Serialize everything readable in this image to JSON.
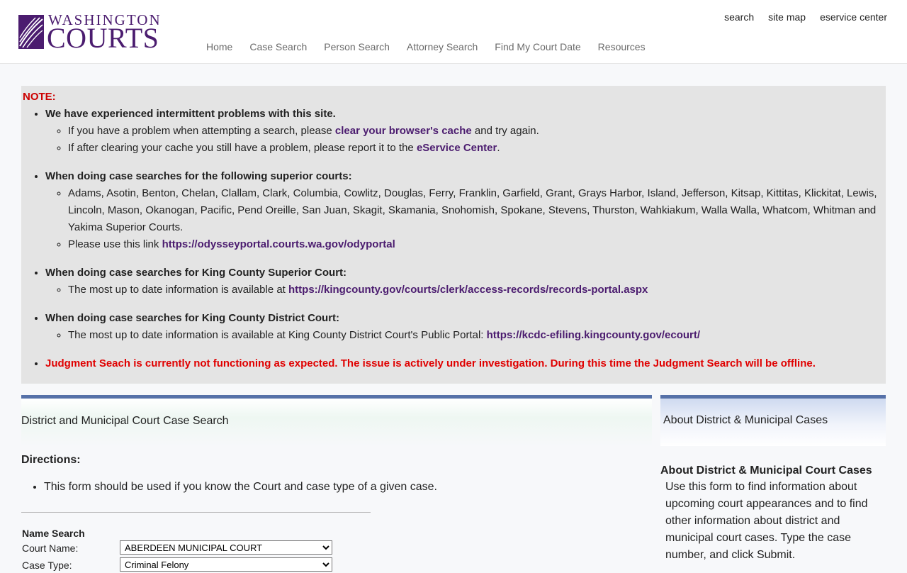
{
  "brand": {
    "top": "WASHINGTON",
    "bottom": "COURTS",
    "color": "#4b1c6f"
  },
  "utility_links": [
    "search",
    "site map",
    "eservice center"
  ],
  "nav": [
    "Home",
    "Case Search",
    "Person Search",
    "Attorney Search",
    "Find My Court Date",
    "Resources"
  ],
  "notice": {
    "label": "NOTE:",
    "items": [
      {
        "head": "We have experienced intermittent problems with this site.",
        "sub": [
          {
            "pre": "If you have a problem when attempting a search, please ",
            "link": "clear your browser's cache",
            "post": " and try again."
          },
          {
            "pre": "If after clearing your cache you still have a problem, please report it to the ",
            "link": "eService Center",
            "post": "."
          }
        ]
      },
      {
        "head": "When doing case searches for the following superior courts:",
        "sub": [
          {
            "pre": "Adams, Asotin, Benton, Chelan, Clallam, Clark, Columbia, Cowlitz, Douglas, Ferry, Franklin, Garfield, Grant, Grays Harbor, Island, Jefferson, Kitsap, Kittitas, Klickitat, Lewis, Lincoln, Mason, Okanogan, Pacific, Pend Oreille, San Juan, Skagit, Skamania, Snohomish, Spokane, Stevens, Thurston, Wahkiakum, Walla Walla, Whatcom, Whitman and Yakima Superior Courts.",
            "link": "",
            "post": ""
          },
          {
            "pre": "Please use this link ",
            "link": "https://odysseyportal.courts.wa.gov/odyportal",
            "post": ""
          }
        ]
      },
      {
        "head": "When doing case searches for King County Superior Court:",
        "sub": [
          {
            "pre": "The most up to date information is available at ",
            "link": "https://kingcounty.gov/courts/clerk/access-records/records-portal.aspx",
            "post": ""
          }
        ]
      },
      {
        "head": "When doing case searches for King County District Court:",
        "sub": [
          {
            "pre": "The most up to date information is available at King County District Court's Public Portal: ",
            "link": "https://kcdc-efiling.kingcounty.gov/ecourt/",
            "post": ""
          }
        ]
      }
    ],
    "alert": "Judgment Seach is currently not functioning as expected. The issue is actively under investigation. During this time the Judgment Search will be offline."
  },
  "left": {
    "title": "District and Municipal Court Case Search",
    "directions_label": "Directions:",
    "directions": [
      "This form should be used if you know the Court and case type of a given case."
    ],
    "form": {
      "title": "Name Search",
      "court_label": "Court Name:",
      "court_value": "ABERDEEN MUNICIPAL COURT",
      "case_type_label": "Case Type:",
      "case_type_value": "Criminal Felony"
    }
  },
  "right": {
    "title": "About District & Municipal Cases",
    "about_title": "About District & Municipal Court Cases",
    "about_text": "Use this form to find information about upcoming court appearances and to find other information about district and municipal court cases. Type the case number, and click Submit."
  }
}
